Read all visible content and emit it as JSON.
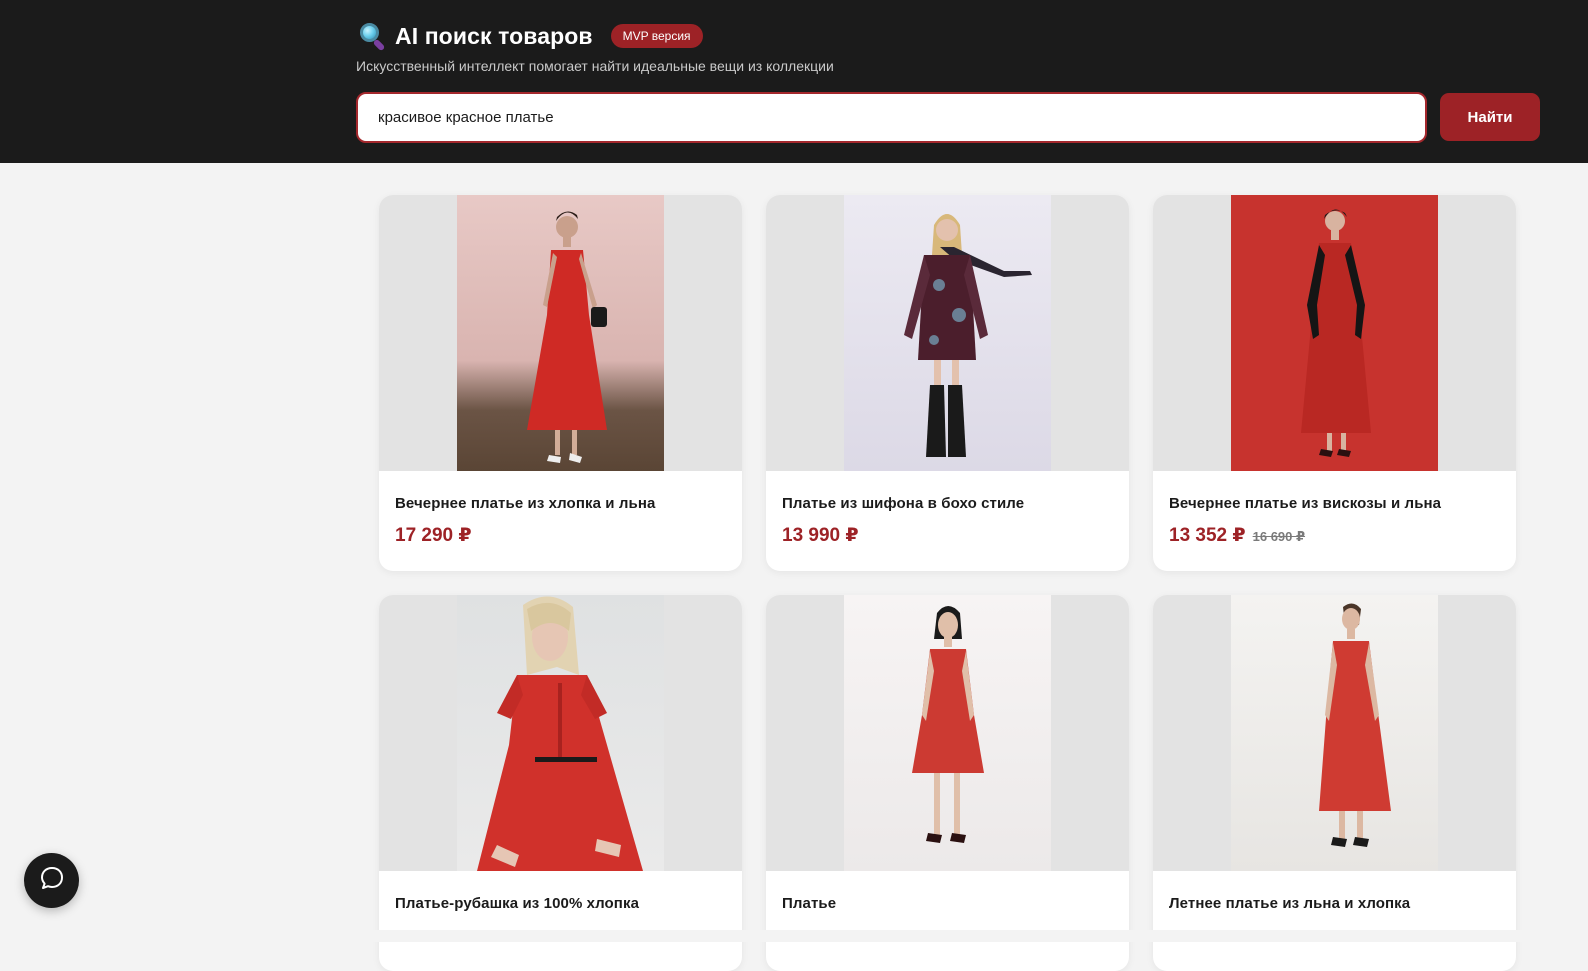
{
  "header": {
    "title": "AI поиск товаров",
    "badge": "MVP версия",
    "subtitle": "Искусственный интеллект помогает найти идеальные вещи из коллекции",
    "title_icon": "magnifying-glass-icon"
  },
  "search": {
    "value": "красивое красное платье",
    "button_label": "Найти"
  },
  "products": [
    {
      "name": "Вечернее платье из хлопка и льна",
      "price": "17 290 ₽",
      "old_price": ""
    },
    {
      "name": "Платье из шифона в бохо стиле",
      "price": "13 990 ₽",
      "old_price": ""
    },
    {
      "name": "Вечернее платье из вискозы и льна",
      "price": "13 352 ₽",
      "old_price": "16 690 ₽"
    },
    {
      "name": "Платье-рубашка из 100% хлопка",
      "price": "",
      "old_price": ""
    },
    {
      "name": "Платье",
      "price": "",
      "old_price": ""
    },
    {
      "name": "Летнее платье из льна и хлопка",
      "price": "",
      "old_price": ""
    }
  ],
  "chat": {
    "icon": "chat-bubble-icon"
  },
  "colors": {
    "header_bg": "#1b1b1b",
    "accent": "#9d2226",
    "page_bg": "#f3f3f3"
  }
}
